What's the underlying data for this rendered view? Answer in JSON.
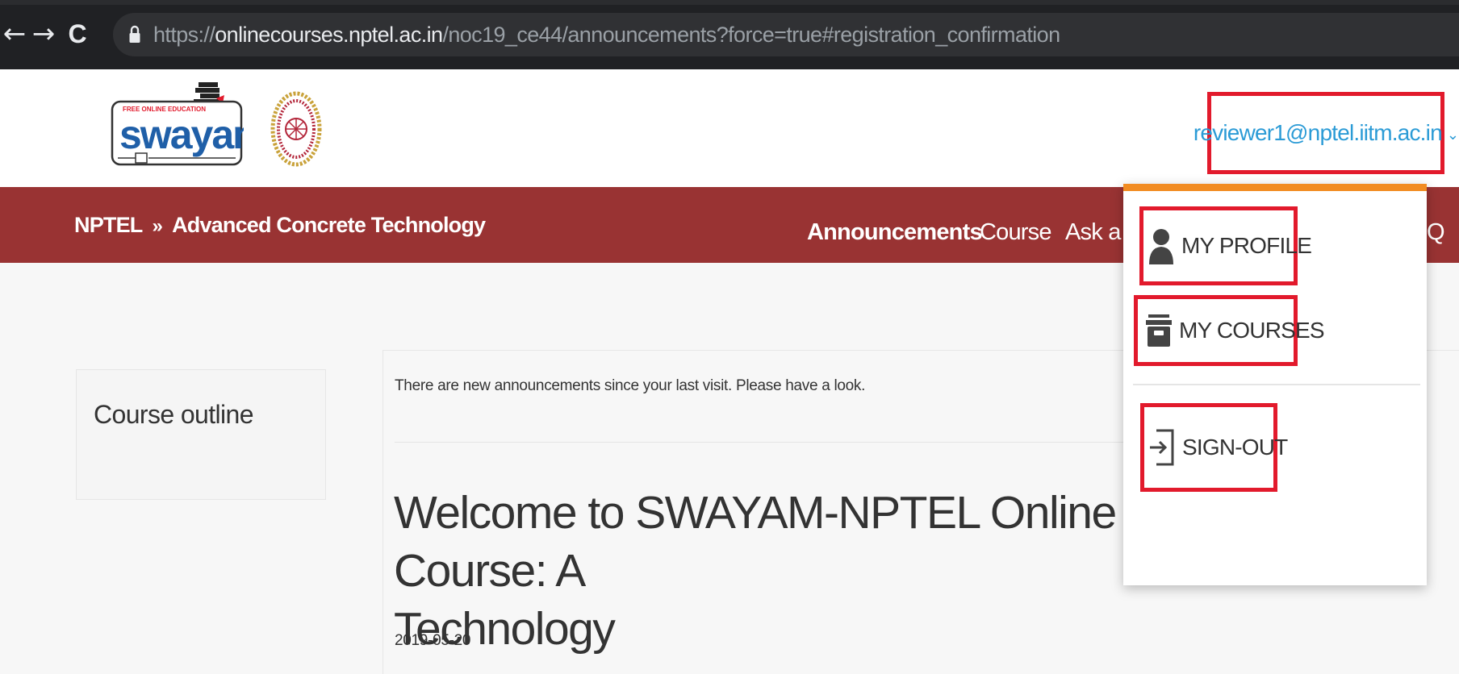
{
  "browser": {
    "back_glyph": "←",
    "forward_glyph": "→",
    "reload_glyph": "C",
    "url_scheme": "https://",
    "url_host": "onlinecourses.nptel.ac.in",
    "url_path": "/noc19_ce44/announcements?force=true#registration_confirmation"
  },
  "header": {
    "logo_text": "swayam",
    "logo_tagline": "FREE ONLINE EDUCATION",
    "user_email": "reviewer1@nptel.iitm.ac.in",
    "caret_glyph": "⌄"
  },
  "nav": {
    "breadcrumb_root": "NPTEL",
    "breadcrumb_sep": "»",
    "breadcrumb_course": "Advanced Concrete Technology",
    "links": [
      {
        "label": "Announcements"
      },
      {
        "label": "Course"
      },
      {
        "label": "Ask a C"
      },
      {
        "label": "Q"
      }
    ]
  },
  "sidebar": {
    "title": "Course outline"
  },
  "main": {
    "notice": "There are new announcements since your last visit. Please have a look.",
    "announcement_title": "Welcome to SWAYAM-NPTEL Online Course: A\nTechnology",
    "announcement_date": "2019-05-20"
  },
  "dropdown": {
    "items": [
      {
        "label": "MY PROFILE",
        "icon": "user-icon"
      },
      {
        "label": "MY COURSES",
        "icon": "courses-icon"
      },
      {
        "label": "SIGN-OUT",
        "icon": "sign-out-icon"
      }
    ]
  },
  "colors": {
    "nav_red": "#993333",
    "accent_orange": "#f28c22",
    "link_blue": "#2b9bd6",
    "highlight_red": "#e21a2c"
  }
}
